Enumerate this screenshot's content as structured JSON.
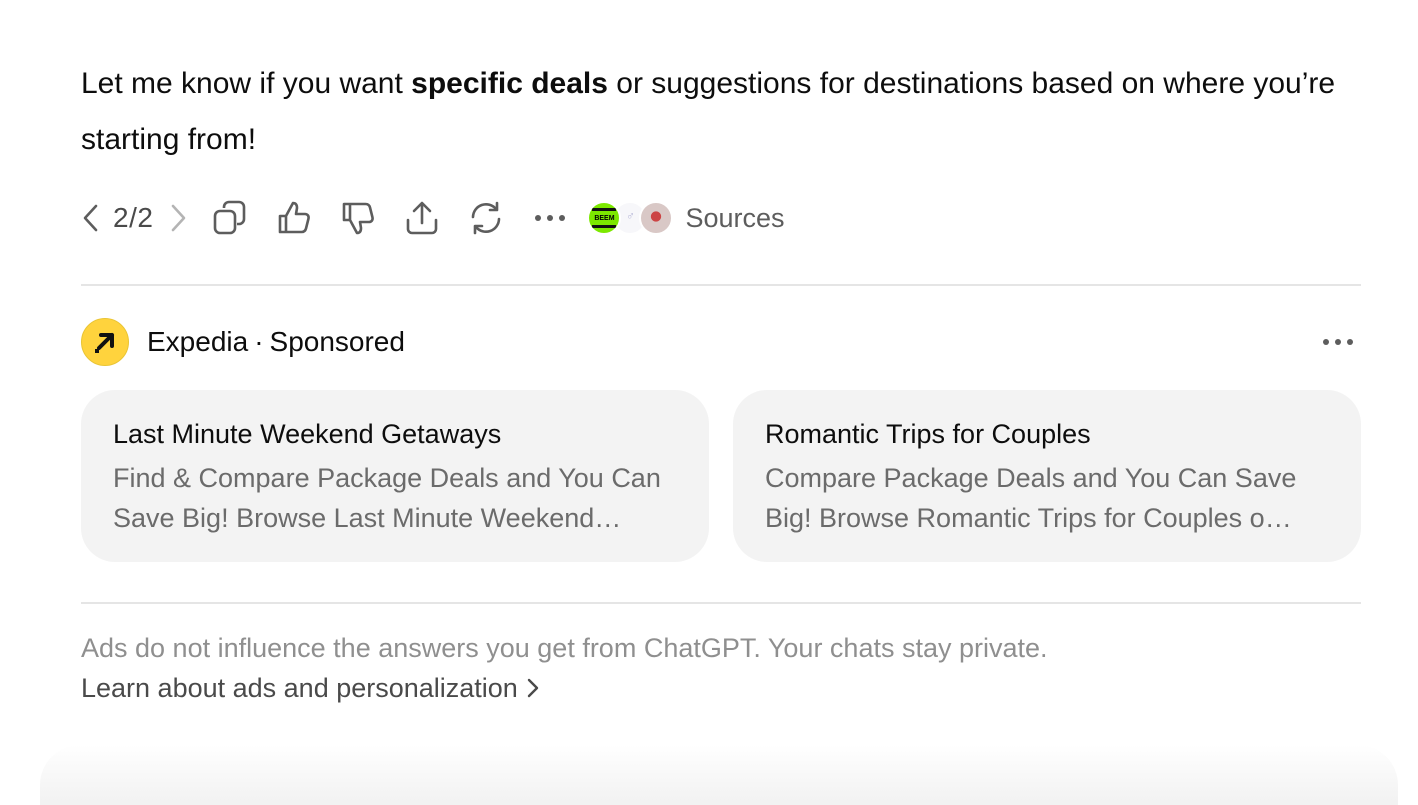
{
  "message": {
    "part1": "Let me know if you want ",
    "bold": "specific deals",
    "part2": " or suggestions for destinations based on where you’re starting from!"
  },
  "actions": {
    "pager": "2/2",
    "icons": [
      "chevron-left-icon",
      "chevron-right-icon",
      "copy-icon",
      "thumbs-up-icon",
      "thumbs-down-icon",
      "share-icon",
      "regenerate-icon",
      "more-icon"
    ],
    "sources_label": "Sources",
    "source_favicon_text": "BEEM"
  },
  "ad": {
    "brand": "Expedia",
    "separator": "·",
    "sponsored": "Sponsored",
    "brand_color": "#ffd33d",
    "cards": [
      {
        "title": "Last Minute Weekend Getaways",
        "description": "Find & Compare Package Deals and You Can Save Big! Browse Last Minute Weekend Getaways today."
      },
      {
        "title": "Romantic Trips for Couples",
        "description": "Compare Package Deals and You Can Save Big! Browse Romantic Trips for Couples o…"
      }
    ]
  },
  "footer": {
    "disclaimer": "Ads do not influence the answers you get from ChatGPT. Your chats stay private.",
    "learn_link": "Learn about ads and personalization"
  }
}
